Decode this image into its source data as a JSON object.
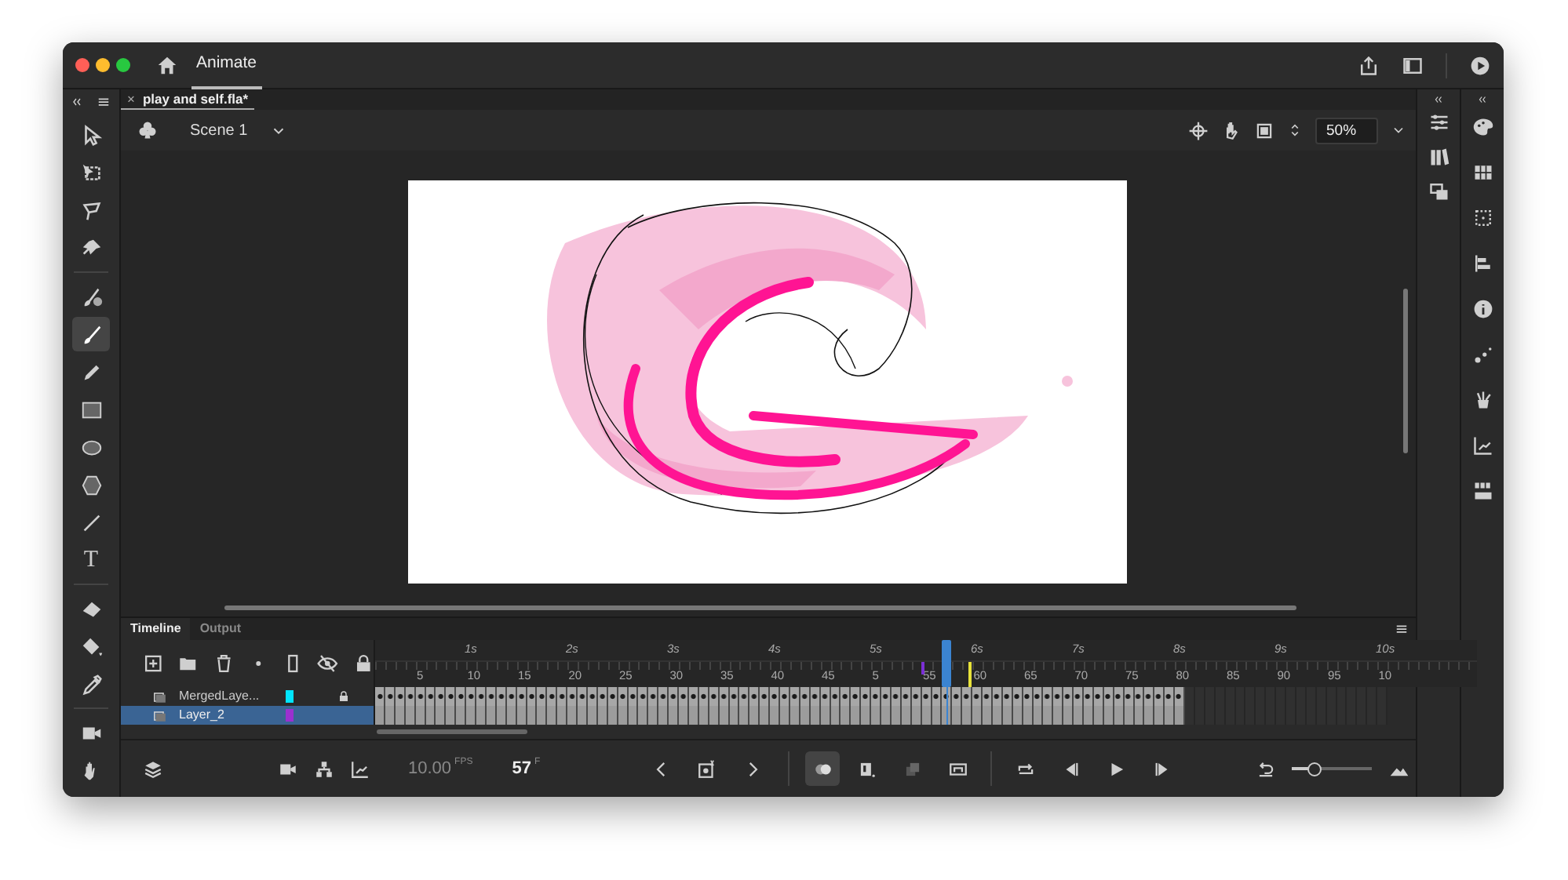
{
  "window": {
    "app_tab": {
      "label": "Animate",
      "selected": true
    }
  },
  "document_tabs": [
    {
      "title": "play and self.fla*",
      "close": "×",
      "selected": true
    }
  ],
  "edit_bar": {
    "scene": "Scene 1",
    "zoom": "50%"
  },
  "tools": [
    {
      "selected": false
    },
    {
      "selected": false
    },
    {
      "selected": false
    },
    {
      "selected": false
    },
    {
      "selected": false
    },
    {
      "selected": true
    },
    {
      "selected": false
    },
    {
      "selected": false
    },
    {
      "selected": false
    },
    {
      "selected": false
    },
    {
      "selected": false
    },
    {
      "label": "T",
      "selected": false
    },
    {
      "selected": false
    },
    {
      "selected": false
    },
    {
      "selected": false
    },
    {
      "selected": false
    },
    {
      "selected": false
    }
  ],
  "timeline": {
    "tabs": [
      {
        "label": "Timeline",
        "selected": true
      },
      {
        "label": "Output",
        "selected": false
      }
    ],
    "seconds": [
      "1s",
      "2s",
      "3s",
      "4s",
      "5s",
      "6s",
      "7s",
      "8s",
      "9s",
      "10s"
    ],
    "frame_numbers": [
      "5",
      "10",
      "15",
      "20",
      "25",
      "30",
      "35",
      "40",
      "45",
      "5",
      "55",
      "60",
      "65",
      "70",
      "75",
      "80",
      "85",
      "90",
      "95",
      "10"
    ],
    "layers": [
      {
        "name": "MergedLaye...",
        "color": "#00e5ff",
        "locked": true,
        "selected": false
      },
      {
        "name": "Layer_2",
        "color": "#9b30d0",
        "locked": false,
        "selected": true
      }
    ],
    "fps": "10.00",
    "fps_unit": "FPS",
    "current_frame": "57",
    "frame_unit": "F",
    "onion_skin": {
      "on": true
    },
    "zoom_slider": {
      "level": 0.28
    }
  }
}
